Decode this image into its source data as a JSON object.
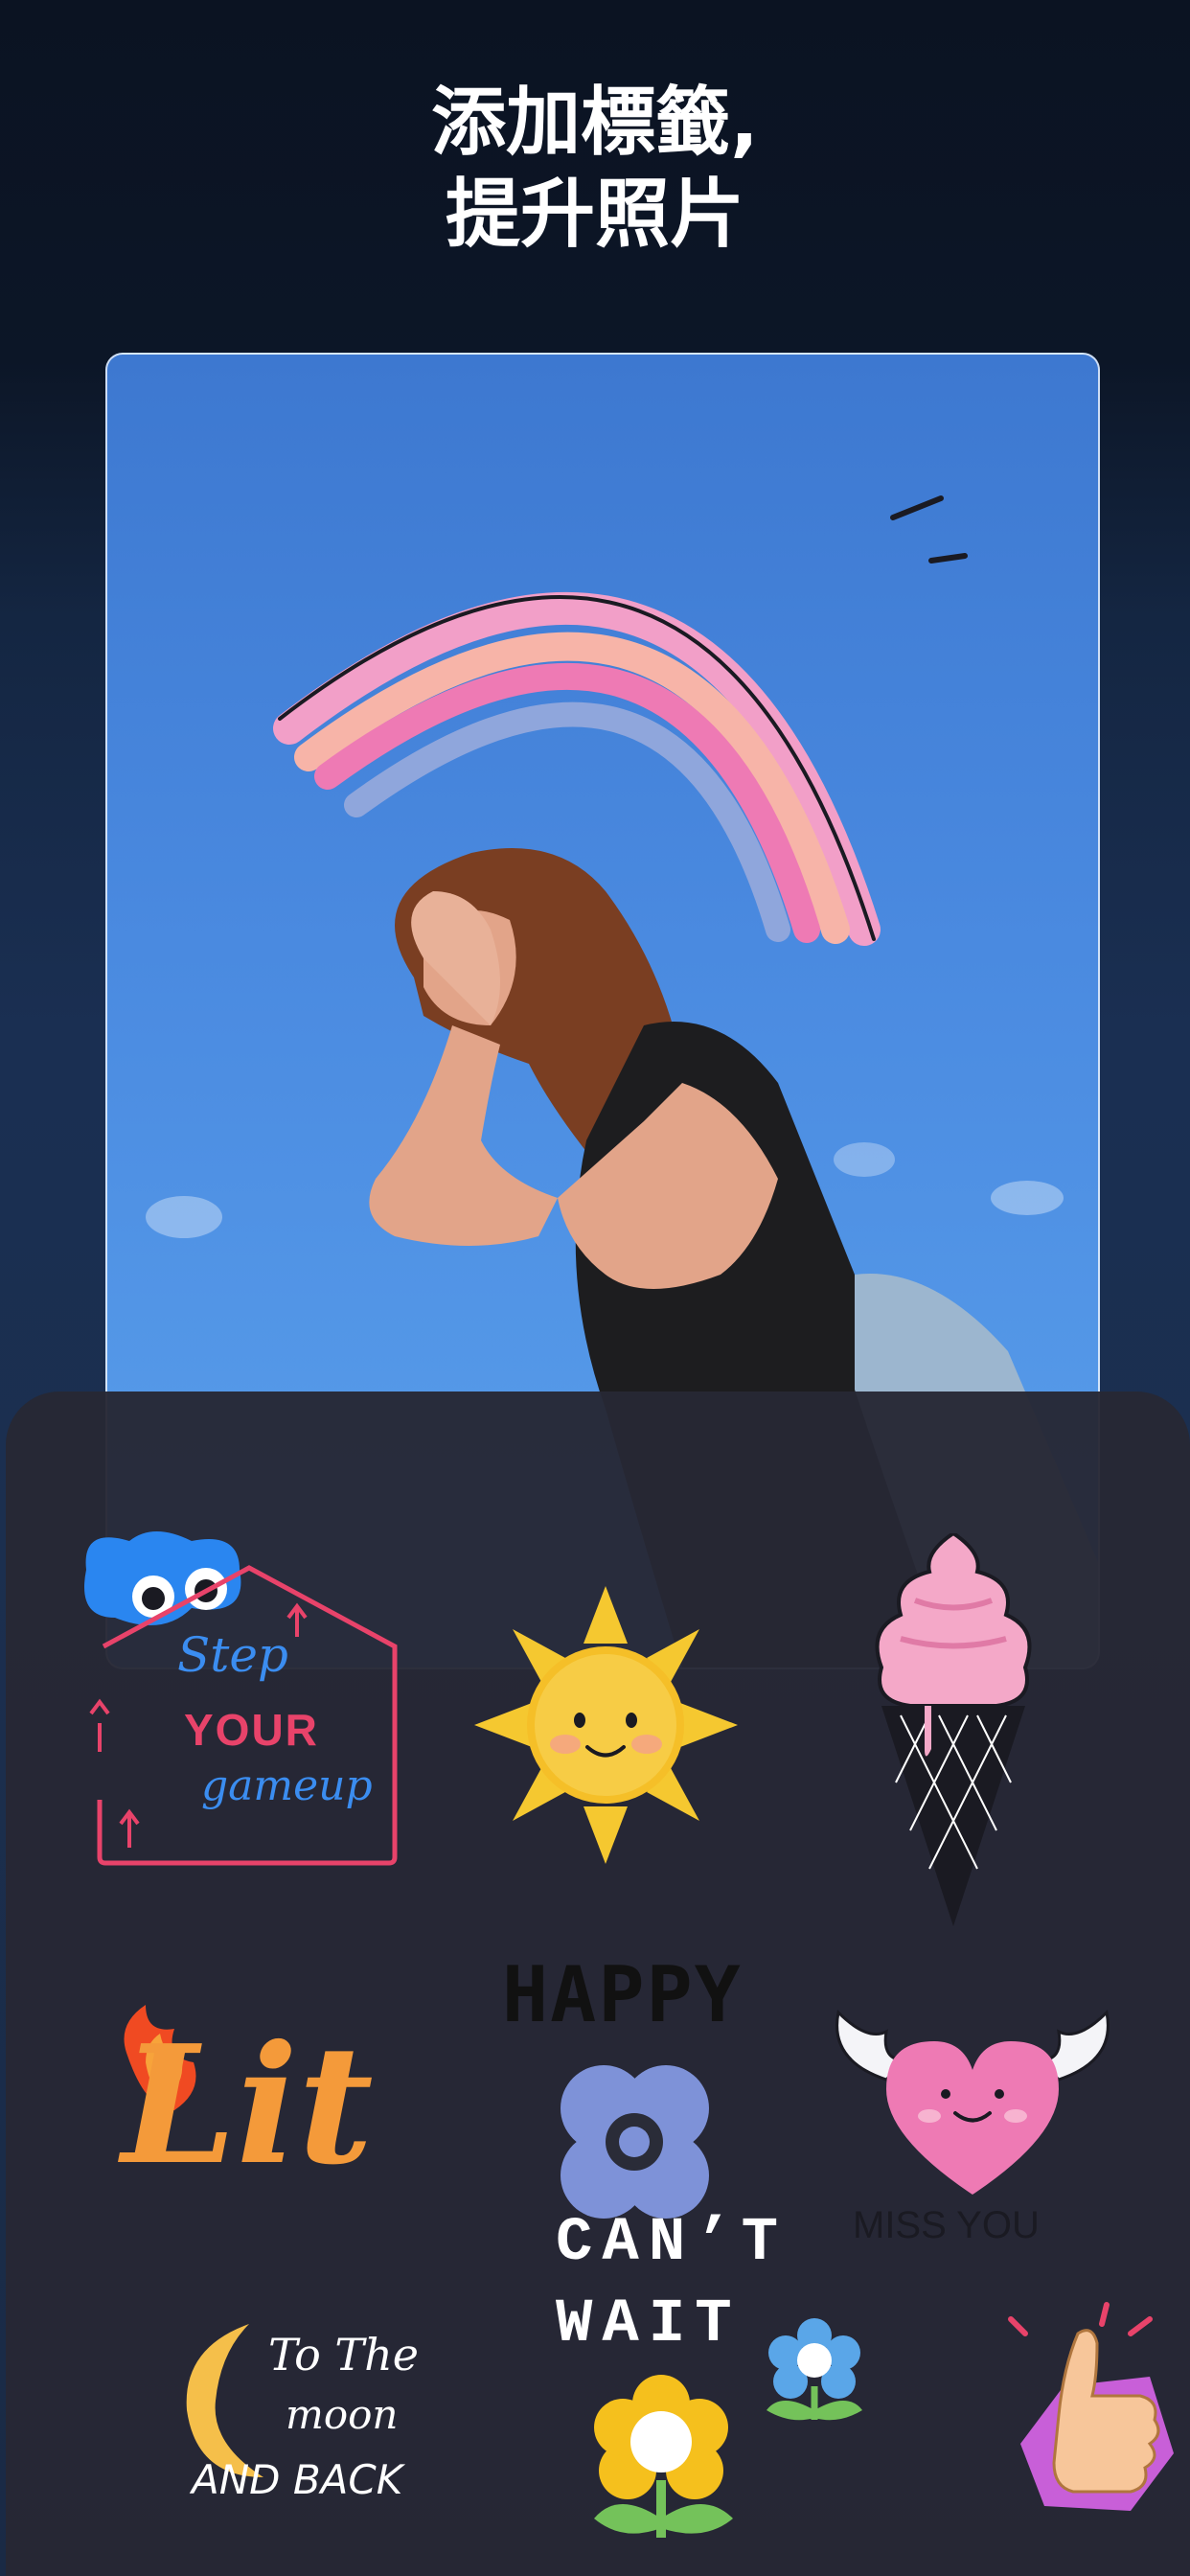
{
  "headline": {
    "line1": "添加標籤,",
    "line2": "提升照片"
  },
  "photo": {
    "description_icon": "photo-woman-laughing-rainbow"
  },
  "stickers": {
    "step": {
      "line1": "Step",
      "line2": "YOUR",
      "line3": "gameup"
    },
    "lit": {
      "text": "Lit"
    },
    "happy": {
      "text": "HAPPY"
    },
    "cant_wait": {
      "line1": "CAN’T",
      "line2": "WAIT"
    },
    "miss_you": {
      "text": "MISS YOU"
    },
    "moon": {
      "line1": "To The",
      "line2": "moon",
      "line3": "AND BACK"
    }
  },
  "colors": {
    "background_top": "#0b1322",
    "background_bottom": "#1a2a45",
    "sheet": "#262834",
    "sky": "#4a8ae0",
    "accent_pink": "#e8436a",
    "accent_blue": "#3b8df0"
  }
}
